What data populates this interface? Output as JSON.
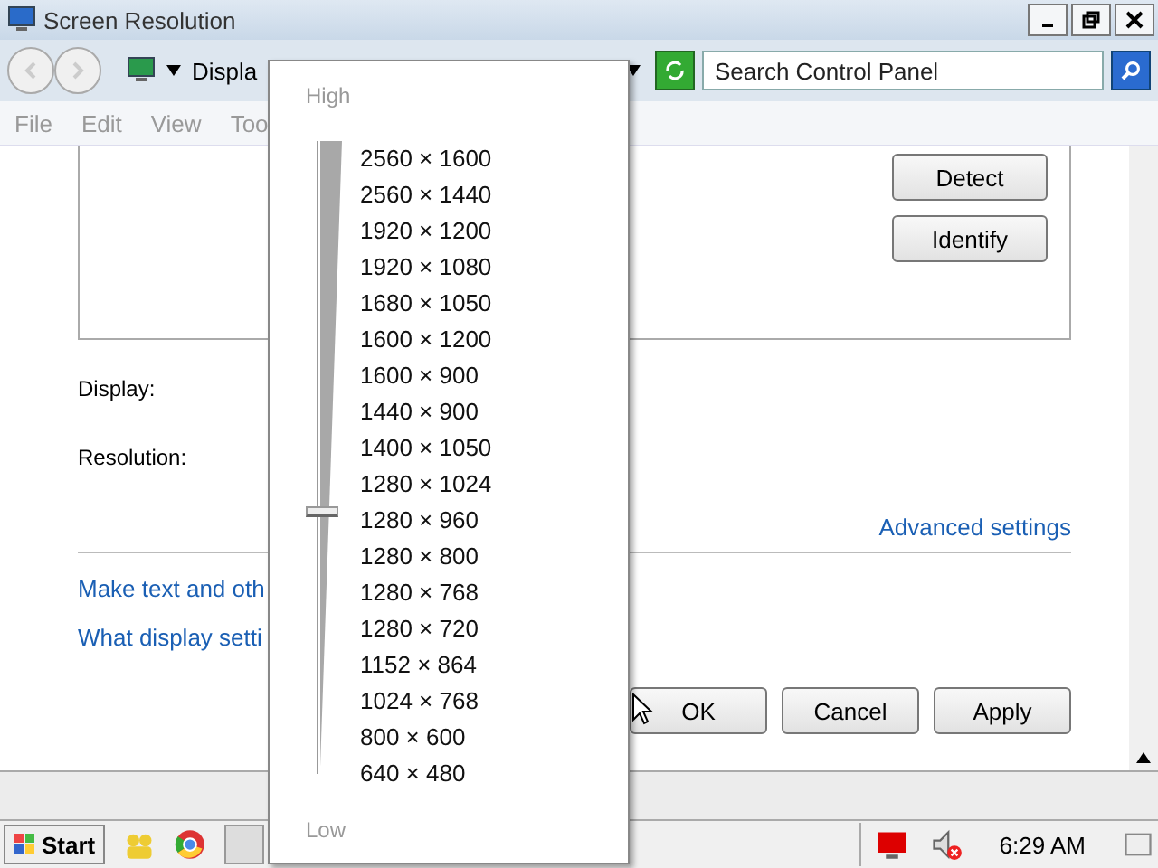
{
  "window": {
    "title": "Screen Resolution"
  },
  "address_bar": {
    "crumb": "Displa"
  },
  "search": {
    "placeholder": "Search Control Panel"
  },
  "menu": [
    "File",
    "Edit",
    "View",
    "Too"
  ],
  "preview_buttons": [
    "Detect",
    "Identify"
  ],
  "fields": [
    "Display:",
    "Resolution:"
  ],
  "advanced_link": "Advanced settings",
  "links": [
    "Make text and oth",
    "What display setti"
  ],
  "buttons": [
    "OK",
    "Cancel",
    "Apply"
  ],
  "resolution_dropdown": {
    "high_label": "High",
    "low_label": "Low",
    "level": 0.41,
    "options": [
      "2560 × 1600",
      "2560 × 1440",
      "1920 × 1200",
      "1920 × 1080",
      "1680 × 1050",
      "1600 × 1200",
      "1600 × 900",
      "1440 × 900",
      "1400 × 1050",
      "1280 × 1024",
      "1280 × 960",
      "1280 × 800",
      "1280 × 768",
      "1280 × 720",
      "1152 × 864",
      "1024 × 768",
      "800 × 600",
      "640 × 480"
    ]
  },
  "taskbar": {
    "start": "Start",
    "clock": "6:29 AM"
  }
}
